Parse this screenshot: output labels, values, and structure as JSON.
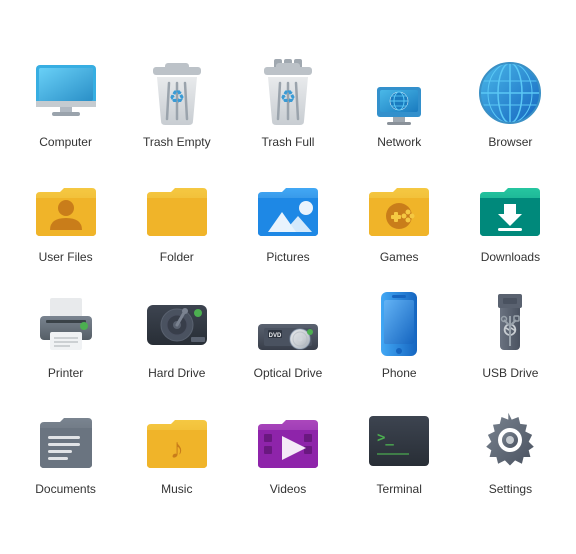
{
  "icons": [
    {
      "id": "computer",
      "label": "Computer"
    },
    {
      "id": "trash-empty",
      "label": "Trash Empty"
    },
    {
      "id": "trash-full",
      "label": "Trash Full"
    },
    {
      "id": "network",
      "label": "Network"
    },
    {
      "id": "browser",
      "label": "Browser"
    },
    {
      "id": "user-files",
      "label": "User Files"
    },
    {
      "id": "folder",
      "label": "Folder"
    },
    {
      "id": "pictures",
      "label": "Pictures"
    },
    {
      "id": "games",
      "label": "Games"
    },
    {
      "id": "downloads",
      "label": "Downloads"
    },
    {
      "id": "printer",
      "label": "Printer"
    },
    {
      "id": "hard-drive",
      "label": "Hard Drive"
    },
    {
      "id": "optical-drive",
      "label": "Optical Drive"
    },
    {
      "id": "phone",
      "label": "Phone"
    },
    {
      "id": "usb-drive",
      "label": "USB Drive"
    },
    {
      "id": "documents",
      "label": "Documents"
    },
    {
      "id": "music",
      "label": "Music"
    },
    {
      "id": "videos",
      "label": "Videos"
    },
    {
      "id": "terminal",
      "label": "Terminal"
    },
    {
      "id": "settings",
      "label": "Settings"
    }
  ]
}
